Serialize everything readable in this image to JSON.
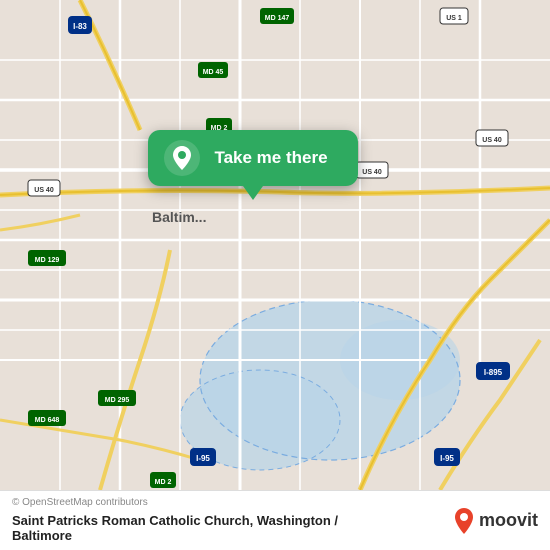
{
  "map": {
    "background_color": "#e8e0d8",
    "center": "Baltimore, MD",
    "attribution": "© OpenStreetMap contributors"
  },
  "callout": {
    "label": "Take me there",
    "pin_color": "#ffffff",
    "background_color": "#2eaa60"
  },
  "footer": {
    "copyright": "© OpenStreetMap contributors",
    "place_name": "Saint Patricks Roman Catholic Church, Washington /",
    "place_name2": "Baltimore",
    "moovit_text": "moovit"
  }
}
